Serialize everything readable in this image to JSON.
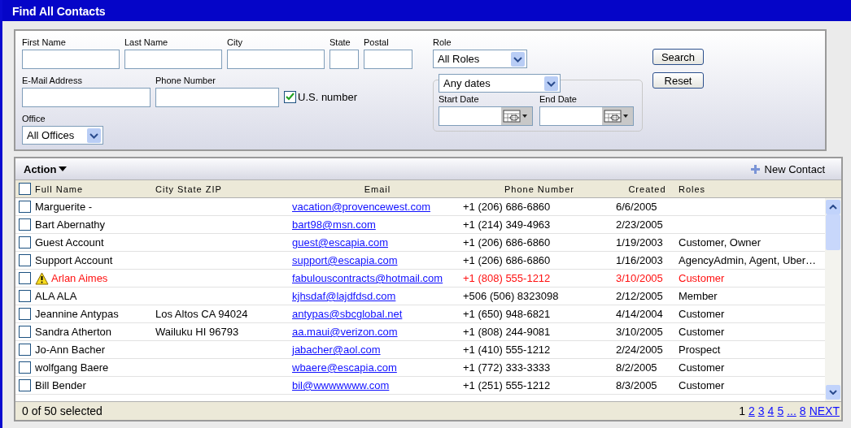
{
  "window": {
    "title": "Find All Contacts"
  },
  "search_form": {
    "fields": [
      {
        "label": "First Name"
      },
      {
        "label": "Last Name"
      },
      {
        "label": "City"
      },
      {
        "label": "State"
      },
      {
        "label": "Postal"
      }
    ],
    "role": {
      "label": "Role",
      "value": "All Roles"
    },
    "email": {
      "label": "E-Mail Address"
    },
    "phone": {
      "label": "Phone Number"
    },
    "us_number": {
      "label": "U.S. number",
      "checked": true
    },
    "office": {
      "label": "Office",
      "value": "All Offices"
    },
    "date_range": {
      "value": "Any dates",
      "start_label": "Start Date",
      "end_label": "End Date"
    },
    "buttons": [
      "Search",
      "Reset"
    ]
  },
  "toolbar": {
    "action": "Action",
    "new_contact": "New Contact"
  },
  "table": {
    "select_all": false,
    "columns": [
      "Full Name",
      "City State ZIP",
      "Email",
      "Phone Number",
      "Created",
      "Roles"
    ],
    "rows": [
      {
        "name": "Marguerite -",
        "location": "",
        "email": "vacation@provencewest.com",
        "phone": "+1 (206) 686-6860",
        "created": "6/6/2005",
        "roles": "",
        "checked": false,
        "alert": false
      },
      {
        "name": "Bart Abernathy",
        "location": "",
        "email": "bart98@msn.com",
        "phone": "+1 (214) 349-4963",
        "created": "2/23/2005",
        "roles": "",
        "checked": false,
        "alert": false
      },
      {
        "name": "Guest Account",
        "location": "",
        "email": "guest@escapia.com",
        "phone": "+1 (206) 686-6860",
        "created": "1/19/2003",
        "roles": "Customer, Owner",
        "checked": false,
        "alert": false
      },
      {
        "name": "Support Account",
        "location": "",
        "email": "support@escapia.com",
        "phone": "+1 (206) 686-6860",
        "created": "1/16/2003",
        "roles": "AgencyAdmin, Agent, Uber…",
        "checked": false,
        "alert": false
      },
      {
        "name": "Arlan Aimes",
        "location": "",
        "email": "fabulouscontracts@hotmail.com",
        "phone": "+1 (808) 555-1212",
        "created": "3/10/2005",
        "roles": "Customer",
        "checked": false,
        "alert": true
      },
      {
        "name": "ALA ALA",
        "location": "",
        "email": "kjhsdaf@lajdfdsd.com",
        "phone": "+506 (506) 8323098",
        "created": "2/12/2005",
        "roles": "Member",
        "checked": false,
        "alert": false
      },
      {
        "name": "Jeannine Antypas",
        "location": "Los Altos CA 94024",
        "email": "antypas@sbcglobal.net",
        "phone": "+1 (650) 948-6821",
        "created": "4/14/2004",
        "roles": "Customer",
        "checked": false,
        "alert": false
      },
      {
        "name": "Sandra Atherton",
        "location": "Wailuku HI 96793",
        "email": "aa.maui@verizon.com",
        "phone": "+1 (808) 244-9081",
        "created": "3/10/2005",
        "roles": "Customer",
        "checked": false,
        "alert": false
      },
      {
        "name": "Jo-Ann Bacher",
        "location": "",
        "email": "jabacher@aol.com",
        "phone": "+1 (410) 555-1212",
        "created": "2/24/2005",
        "roles": "Prospect",
        "checked": false,
        "alert": false
      },
      {
        "name": "wolfgang Baere",
        "location": "",
        "email": "wbaere@escapia.com",
        "phone": "+1 (772) 333-3333",
        "created": "8/2/2005",
        "roles": "Customer",
        "checked": false,
        "alert": false
      },
      {
        "name": "Bill Bender",
        "location": "",
        "email": "bil@wwwwwww.com",
        "phone": "+1 (251) 555-1212",
        "created": "8/3/2005",
        "roles": "Customer",
        "checked": false,
        "alert": false
      }
    ]
  },
  "status": "0 of 50 selected",
  "pagination": [
    {
      "label": "1",
      "selected": true
    },
    {
      "label": "2",
      "selected": false
    },
    {
      "label": "3",
      "selected": false
    },
    {
      "label": "4",
      "selected": false
    },
    {
      "label": "5",
      "selected": false
    },
    {
      "label": "...",
      "selected": false
    },
    {
      "label": "8",
      "selected": false
    },
    {
      "label": "NEXT",
      "selected": false
    }
  ]
}
